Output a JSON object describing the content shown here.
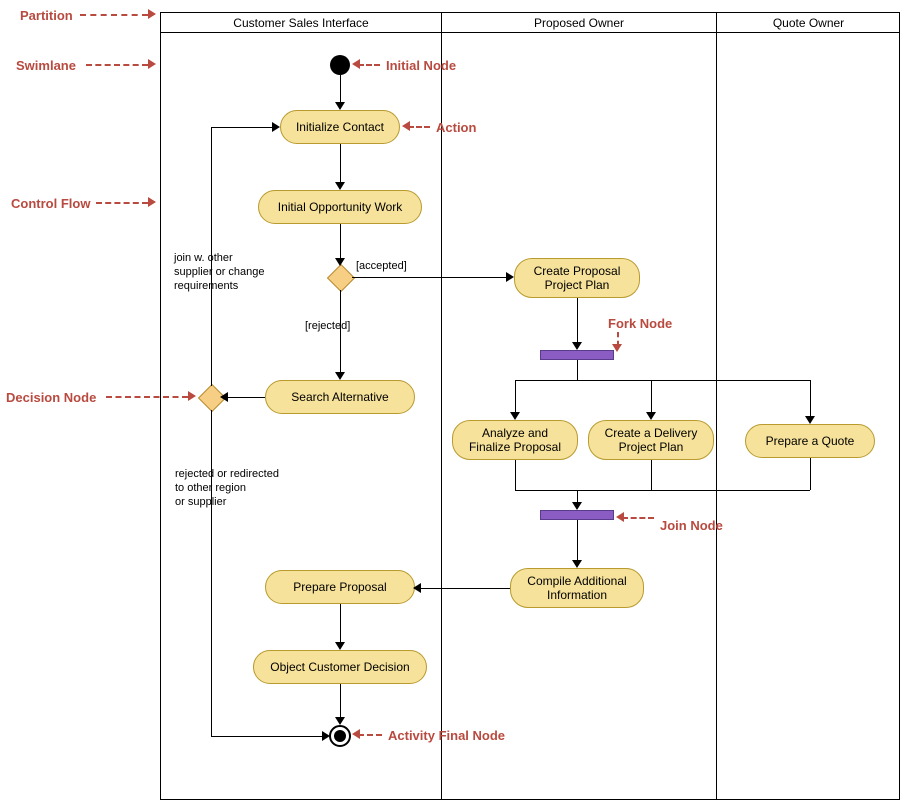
{
  "lanes": {
    "lane1": "Customer Sales Interface",
    "lane2": "Proposed Owner",
    "lane3": "Quote Owner"
  },
  "actions": {
    "initialize_contact": "Initialize Contact",
    "initial_opportunity": "Initial Opportunity Work",
    "search_alternative": "Search Alternative",
    "prepare_proposal": "Prepare Proposal",
    "object_customer": "Object Customer Decision",
    "create_proposal_plan_l1": "Create Proposal",
    "create_proposal_plan_l2": "Project Plan",
    "analyze_finalize_l1": "Analyze and",
    "analyze_finalize_l2": "Finalize Proposal",
    "create_delivery_l1": "Create a Delivery",
    "create_delivery_l2": "Project Plan",
    "prepare_quote": "Prepare a Quote",
    "compile_info_l1": "Compile Additional",
    "compile_info_l2": "Information"
  },
  "guards": {
    "accepted": "[accepted]",
    "rejected": "[rejected]",
    "join_supplier_l1": "join w. other",
    "join_supplier_l2": "supplier or change",
    "join_supplier_l3": "requirements",
    "rejected_redirect_l1": "rejected or redirected",
    "rejected_redirect_l2": "to other region",
    "rejected_redirect_l3": "or supplier"
  },
  "annotations": {
    "partition": "Partition",
    "swimlane": "Swimlane",
    "control_flow": "Control Flow",
    "decision_node": "Decision Node",
    "initial_node": "Initial Node",
    "action": "Action",
    "fork_node": "Fork Node",
    "join_node": "Join Node",
    "activity_final": "Activity Final Node"
  }
}
